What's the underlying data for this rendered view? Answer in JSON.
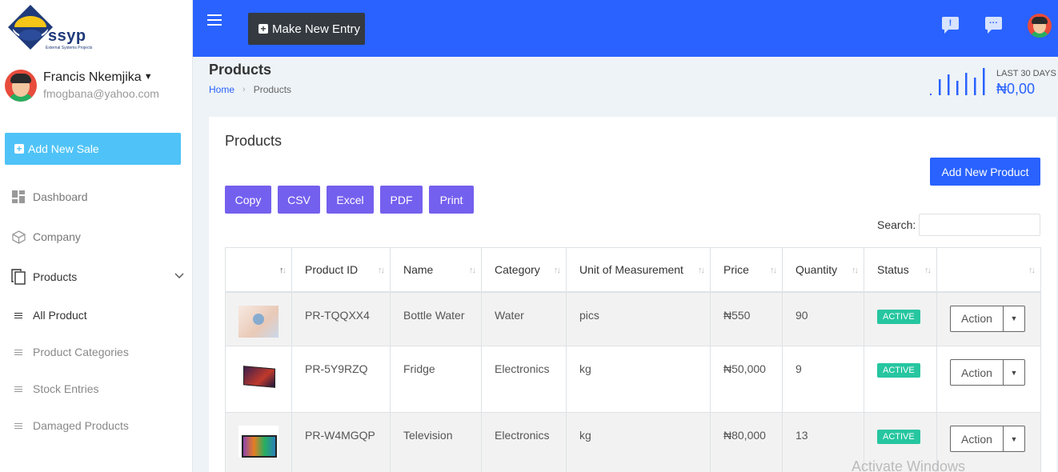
{
  "brand": {
    "name": "ssyp",
    "tagline": "External Systems Projects"
  },
  "user": {
    "name": "Francis Nkemjika",
    "email": "fmogbana@yahoo.com"
  },
  "sidebar": {
    "add_sale_label": "Add New Sale",
    "items": [
      {
        "label": "Dashboard",
        "icon": "dashboard-icon"
      },
      {
        "label": "Company",
        "icon": "cube-icon"
      },
      {
        "label": "Products",
        "icon": "copy-icon"
      }
    ],
    "sub_items": [
      {
        "label": "All Product"
      },
      {
        "label": "Product Categories"
      },
      {
        "label": "Stock Entries"
      },
      {
        "label": "Damaged Products"
      }
    ]
  },
  "topbar": {
    "new_entry_label": "Make New Entry"
  },
  "page": {
    "title": "Products",
    "breadcrumb": {
      "home": "Home",
      "current": "Products"
    },
    "stat": {
      "label": "LAST 30 DAYS",
      "value": "₦0,00"
    }
  },
  "card": {
    "title": "Products",
    "add_product_label": "Add New Product",
    "export_buttons": [
      "Copy",
      "CSV",
      "Excel",
      "PDF",
      "Print"
    ],
    "search_label": "Search:"
  },
  "table": {
    "columns": [
      "",
      "Product ID",
      "Name",
      "Category",
      "Unit of Measurement",
      "Price",
      "Quantity",
      "Status",
      ""
    ],
    "rows": [
      {
        "id": "PR-TQQXX4",
        "name": "Bottle Water",
        "category": "Water",
        "unit": "pics",
        "price": "₦550",
        "quantity": "90",
        "status": "ACTIVE",
        "action": "Action"
      },
      {
        "id": "PR-5Y9RZQ",
        "name": "Fridge",
        "category": "Electronics",
        "unit": "kg",
        "price": "₦50,000",
        "quantity": "9",
        "status": "ACTIVE",
        "action": "Action"
      },
      {
        "id": "PR-W4MGQP",
        "name": "Television",
        "category": "Electronics",
        "unit": "kg",
        "price": "₦80,000",
        "quantity": "13",
        "status": "ACTIVE",
        "action": "Action"
      }
    ]
  },
  "watermark": "Activate Windows",
  "colors": {
    "primary": "#2962ff",
    "export": "#7460ee",
    "info": "#4fc3f7",
    "success": "#26c6a0",
    "dark": "#343a40"
  }
}
